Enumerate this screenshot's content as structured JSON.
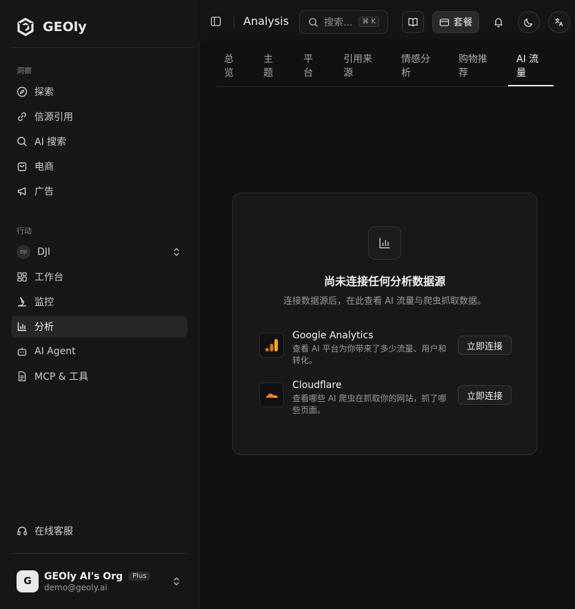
{
  "brand": {
    "name": "GEOly"
  },
  "sidebar": {
    "sections": [
      {
        "label": "洞察",
        "items": [
          {
            "label": "探索",
            "icon": "compass-icon"
          },
          {
            "label": "信源引用",
            "icon": "link-icon"
          },
          {
            "label": "AI 搜索",
            "icon": "search-icon"
          },
          {
            "label": "电商",
            "icon": "shopping-bag-icon"
          },
          {
            "label": "广告",
            "icon": "megaphone-icon"
          }
        ]
      },
      {
        "label": "行动",
        "project": {
          "name": "DJI",
          "avatar_text": "DJI"
        },
        "items": [
          {
            "label": "工作台",
            "icon": "dashboard-icon"
          },
          {
            "label": "监控",
            "icon": "microscope-icon"
          },
          {
            "label": "分析",
            "icon": "bar-chart-icon",
            "active": true
          },
          {
            "label": "AI Agent",
            "icon": "bot-icon"
          },
          {
            "label": "MCP & 工具",
            "icon": "document-icon"
          }
        ]
      }
    ],
    "support": {
      "label": "在线客服",
      "icon": "headset-icon"
    },
    "org": {
      "avatar": "G",
      "name": "GEOly AI's Org",
      "plan": "Plus",
      "email": "demo@geoly.ai"
    }
  },
  "header": {
    "title": "Analysis",
    "search": {
      "placeholder": "搜索...",
      "shortcut": "⌘ K"
    },
    "plan_button": "套餐"
  },
  "tabs": [
    {
      "label": "总览",
      "lines": [
        "总",
        "览"
      ]
    },
    {
      "label": "主题",
      "lines": [
        "主",
        "题"
      ]
    },
    {
      "label": "平台",
      "lines": [
        "平",
        "台"
      ]
    },
    {
      "label": "引用来源",
      "lines": [
        "引用来",
        "源"
      ]
    },
    {
      "label": "情感分析",
      "lines": [
        "情感分",
        "析"
      ]
    },
    {
      "label": "购物推荐",
      "lines": [
        "购物推",
        "荐"
      ]
    },
    {
      "label": "AI 流量",
      "lines": [
        "AI 流",
        "量"
      ],
      "active": true
    }
  ],
  "empty_state": {
    "title": "尚未连接任何分析数据源",
    "subtitle": "连接数据源后，在此查看 AI 流量与爬虫抓取数据。",
    "providers": [
      {
        "name": "Google Analytics",
        "description": "查看 AI 平台为你带来了多少流量、用户和转化。",
        "button": "立即连接",
        "logo": "google-analytics-logo",
        "color": "#F9AB00"
      },
      {
        "name": "Cloudflare",
        "description": "查看哪些 AI 爬虫在抓取你的网站，抓了哪些页面。",
        "button": "立即连接",
        "logo": "cloudflare-logo",
        "color": "#F38020"
      }
    ]
  }
}
